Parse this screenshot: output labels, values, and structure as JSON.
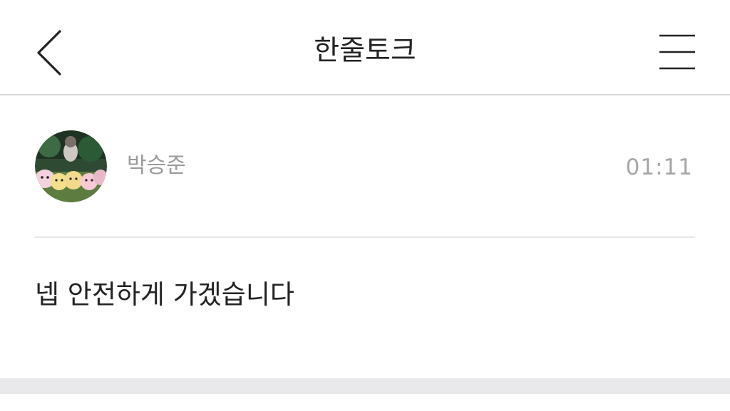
{
  "header": {
    "title": "한줄토크",
    "back_icon": "chevron-left-icon",
    "menu_icon": "hamburger-menu-icon"
  },
  "post": {
    "author": "박승준",
    "time": "01:11",
    "message": "넵 안전하게 가겠습니다"
  },
  "colors": {
    "title_text": "#222222",
    "author_text": "#9a9a9a",
    "time_text": "#a6a6a6",
    "divider": "#e6e6e6",
    "footer_band": "#e9e9ec"
  }
}
